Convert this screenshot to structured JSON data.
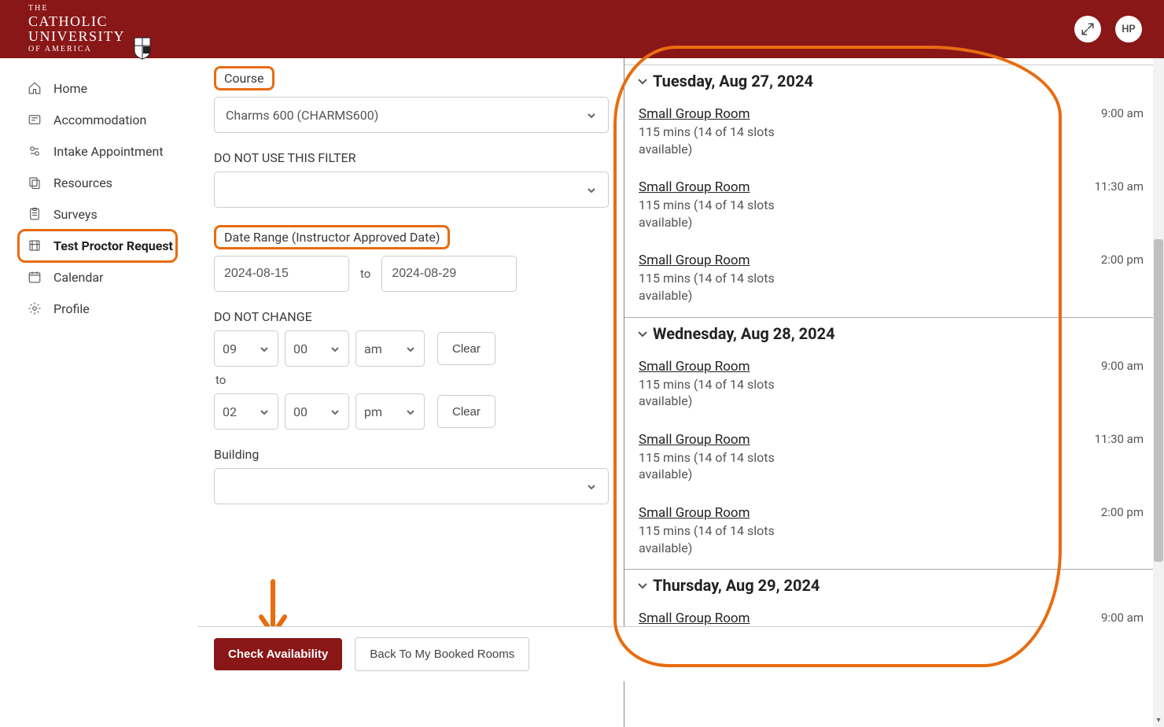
{
  "header": {
    "logo": {
      "l1": "THE",
      "l2": "CATHOLIC",
      "l3": "UNIVERSITY",
      "l4": "OF AMERICA"
    },
    "avatar_initials": "HP"
  },
  "sidebar": {
    "items": [
      {
        "icon": "home-icon",
        "label": "Home"
      },
      {
        "icon": "accommodation-icon",
        "label": "Accommodation"
      },
      {
        "icon": "intake-icon",
        "label": "Intake Appointment"
      },
      {
        "icon": "resources-icon",
        "label": "Resources"
      },
      {
        "icon": "surveys-icon",
        "label": "Surveys"
      },
      {
        "icon": "proctor-icon",
        "label": "Test Proctor Request",
        "active": true
      },
      {
        "icon": "calendar-icon",
        "label": "Calendar"
      },
      {
        "icon": "profile-icon",
        "label": "Profile"
      }
    ]
  },
  "form": {
    "course_label": "Course",
    "course_value": "Charms 600 (CHARMS600)",
    "filter_label": "DO NOT USE THIS FILTER",
    "daterange_label": "Date Range (Instructor Approved Date)",
    "date_from": "2024-08-15",
    "date_to": "2024-08-29",
    "to_word": "to",
    "nochange_label": "DO NOT CHANGE",
    "time_from": {
      "hh": "09",
      "mm": "00",
      "ap": "am"
    },
    "time_to": {
      "hh": "02",
      "mm": "00",
      "ap": "pm"
    },
    "clear_label": "Clear",
    "to_word2": "to",
    "building_label": "Building"
  },
  "footer": {
    "check": "Check Availability",
    "back": "Back To My Booked Rooms"
  },
  "results": {
    "days": [
      {
        "title": "Tuesday, Aug 27, 2024",
        "slots": [
          {
            "room": "Small Group Room",
            "detail": "115 mins (14 of 14 slots available)",
            "time": "9:00 am"
          },
          {
            "room": "Small Group Room",
            "detail": "115 mins (14 of 14 slots available)",
            "time": "11:30 am"
          },
          {
            "room": "Small Group Room",
            "detail": "115 mins (14 of 14 slots available)",
            "time": "2:00 pm"
          }
        ]
      },
      {
        "title": "Wednesday, Aug 28, 2024",
        "slots": [
          {
            "room": "Small Group Room",
            "detail": "115 mins (14 of 14 slots available)",
            "time": "9:00 am"
          },
          {
            "room": "Small Group Room",
            "detail": "115 mins (14 of 14 slots available)",
            "time": "11:30 am"
          },
          {
            "room": "Small Group Room",
            "detail": "115 mins (14 of 14 slots available)",
            "time": "2:00 pm"
          }
        ]
      },
      {
        "title": "Thursday, Aug 29, 2024",
        "slots": [
          {
            "room": "Small Group Room",
            "detail": "",
            "time": "9:00 am"
          }
        ]
      }
    ]
  }
}
